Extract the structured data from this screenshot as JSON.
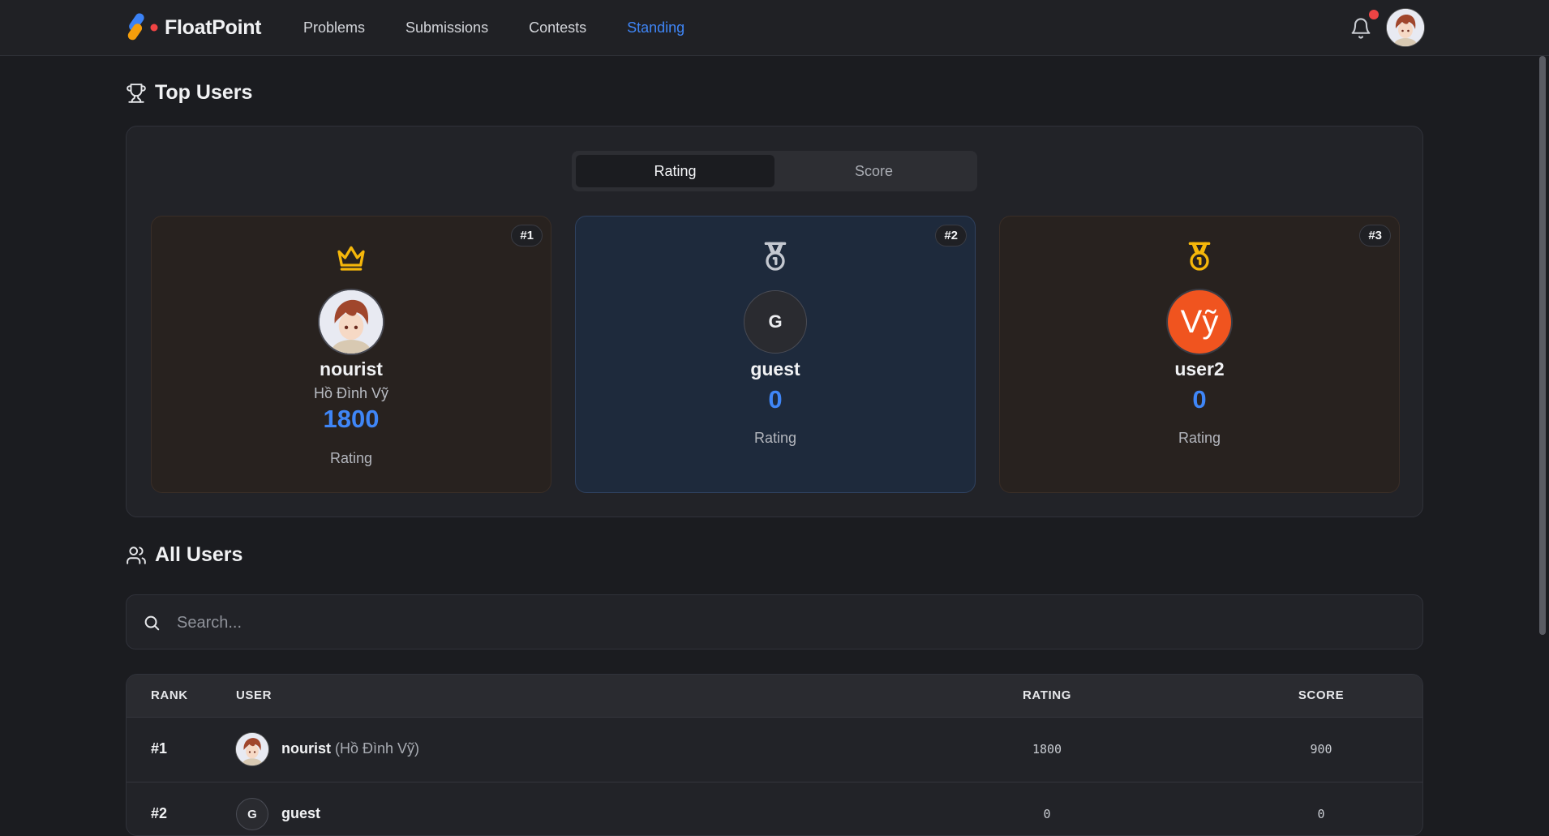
{
  "app": {
    "name": "FloatPoint"
  },
  "nav": {
    "items": [
      "Problems",
      "Submissions",
      "Contests",
      "Standing"
    ],
    "active": "Standing"
  },
  "top_users": {
    "title": "Top Users",
    "tabs": [
      "Rating",
      "Score"
    ],
    "active_tab": "Rating",
    "cards": [
      {
        "rank": "#1",
        "medal": "crown-icon",
        "username": "nourist",
        "full_name": "Hồ Đình Vỹ",
        "value": "1800",
        "label": "Rating"
      },
      {
        "rank": "#2",
        "medal": "silver-medal-icon",
        "avatar_letter": "G",
        "username": "guest",
        "value": "0",
        "label": "Rating"
      },
      {
        "rank": "#3",
        "medal": "bronze-medal-icon",
        "avatar_letter": "Vỹ",
        "username": "user2",
        "value": "0",
        "label": "Rating"
      }
    ]
  },
  "all_users": {
    "title": "All Users",
    "search_placeholder": "Search...",
    "columns": [
      "RANK",
      "USER",
      "RATING",
      "SCORE"
    ],
    "rows": [
      {
        "rank": "#1",
        "username": "nourist",
        "full_name": "(Hồ Đình Vỹ)",
        "rating": "1800",
        "score": "900"
      },
      {
        "rank": "#2",
        "avatar_letter": "G",
        "username": "guest",
        "full_name": "",
        "rating": "0",
        "score": "0"
      }
    ]
  },
  "colors": {
    "accent": "#3f86f7",
    "background": "#1b1c20",
    "gold": "#f5b70a",
    "avatar_orange": "#f0541f",
    "notification": "#ef4444"
  }
}
